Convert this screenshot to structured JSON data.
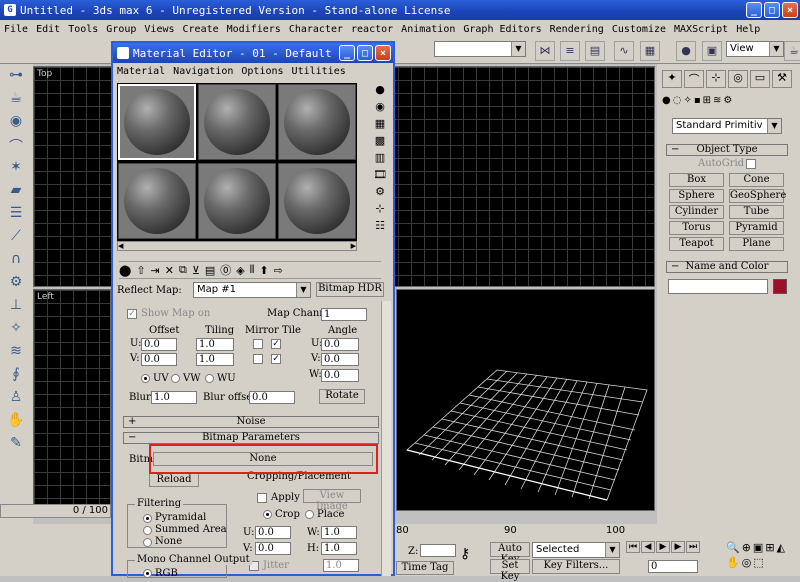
{
  "app": {
    "title": "Untitled - 3ds max 6 - Unregistered Version - Stand-alone License",
    "menu": [
      "File",
      "Edit",
      "Tools",
      "Group",
      "Views",
      "Create",
      "Modifiers",
      "Character",
      "reactor",
      "Animation",
      "Graph Editors",
      "Rendering",
      "Customize",
      "MAXScript",
      "Help"
    ],
    "view_combo": "View"
  },
  "viewports": {
    "top_label": "Top",
    "left_label": "Left"
  },
  "command_panel": {
    "category": "Standard Primitiv",
    "object_type_header": "Object Type",
    "autogrid": "AutoGrid",
    "primitives": [
      "Box",
      "Cone",
      "Sphere",
      "GeoSphere",
      "Cylinder",
      "Tube",
      "Torus",
      "Pyramid",
      "Teapot",
      "Plane"
    ],
    "name_color_header": "Name and Color",
    "color": "#9b1028"
  },
  "material_editor": {
    "title": "Material Editor - 01 - Default",
    "menu": [
      "Material",
      "Navigation",
      "Options",
      "Utilities"
    ],
    "reflect_label": "Reflect Map:",
    "map_name": "Map #1",
    "map_type": "Bitmap HDR",
    "show_map_on": "Show Map on",
    "map_channel_label": "Map Channel:",
    "map_channel": "1",
    "offset_label": "Offset",
    "tiling_label": "Tiling",
    "mirror_tile_label": "Mirror Tile",
    "angle_label": "Angle",
    "u_label": "U:",
    "v_label": "V:",
    "w_label": "W:",
    "offset_u": "0.0",
    "offset_v": "0.0",
    "tiling_u": "1.0",
    "tiling_v": "1.0",
    "angle_u": "0.0",
    "angle_v": "0.0",
    "angle_w": "0.0",
    "uv": "UV",
    "vw": "VW",
    "wu": "WU",
    "blur_label": "Blur:",
    "blur": "1.0",
    "blur_offset_label": "Blur offset:",
    "blur_offset": "0.0",
    "rotate": "Rotate",
    "noise_header": "Noise",
    "bitmap_params_header": "Bitmap Parameters",
    "bitmap_label": "Bitmap:",
    "bitmap_value": "None",
    "reload": "Reload",
    "cropping_header": "Cropping/Placement",
    "apply": "Apply",
    "view_image": "View Image",
    "crop": "Crop",
    "place": "Place",
    "crop_u_label": "U:",
    "crop_u": "0.0",
    "crop_w_label": "W:",
    "crop_w": "1.0",
    "crop_v_label": "V:",
    "crop_v": "0.0",
    "crop_h_label": "H:",
    "crop_h": "1.0",
    "jitter": "Jitter",
    "jitter_val": "1.0",
    "filtering_header": "Filtering",
    "pyramidal": "Pyramidal",
    "summed_area": "Summed Area",
    "filter_none": "None",
    "mono_header": "Mono Channel Output",
    "rgb": "RGB"
  },
  "bottom": {
    "frame": "0 / 100",
    "ticks": [
      "80",
      "90",
      "100"
    ],
    "auto_key": "Auto Key",
    "selected": "Selected",
    "set_key": "Set Key",
    "key_filters": "Key Filters...",
    "time_tag": "Time Tag",
    "z_label": "Z:",
    "current_frame": "0"
  }
}
